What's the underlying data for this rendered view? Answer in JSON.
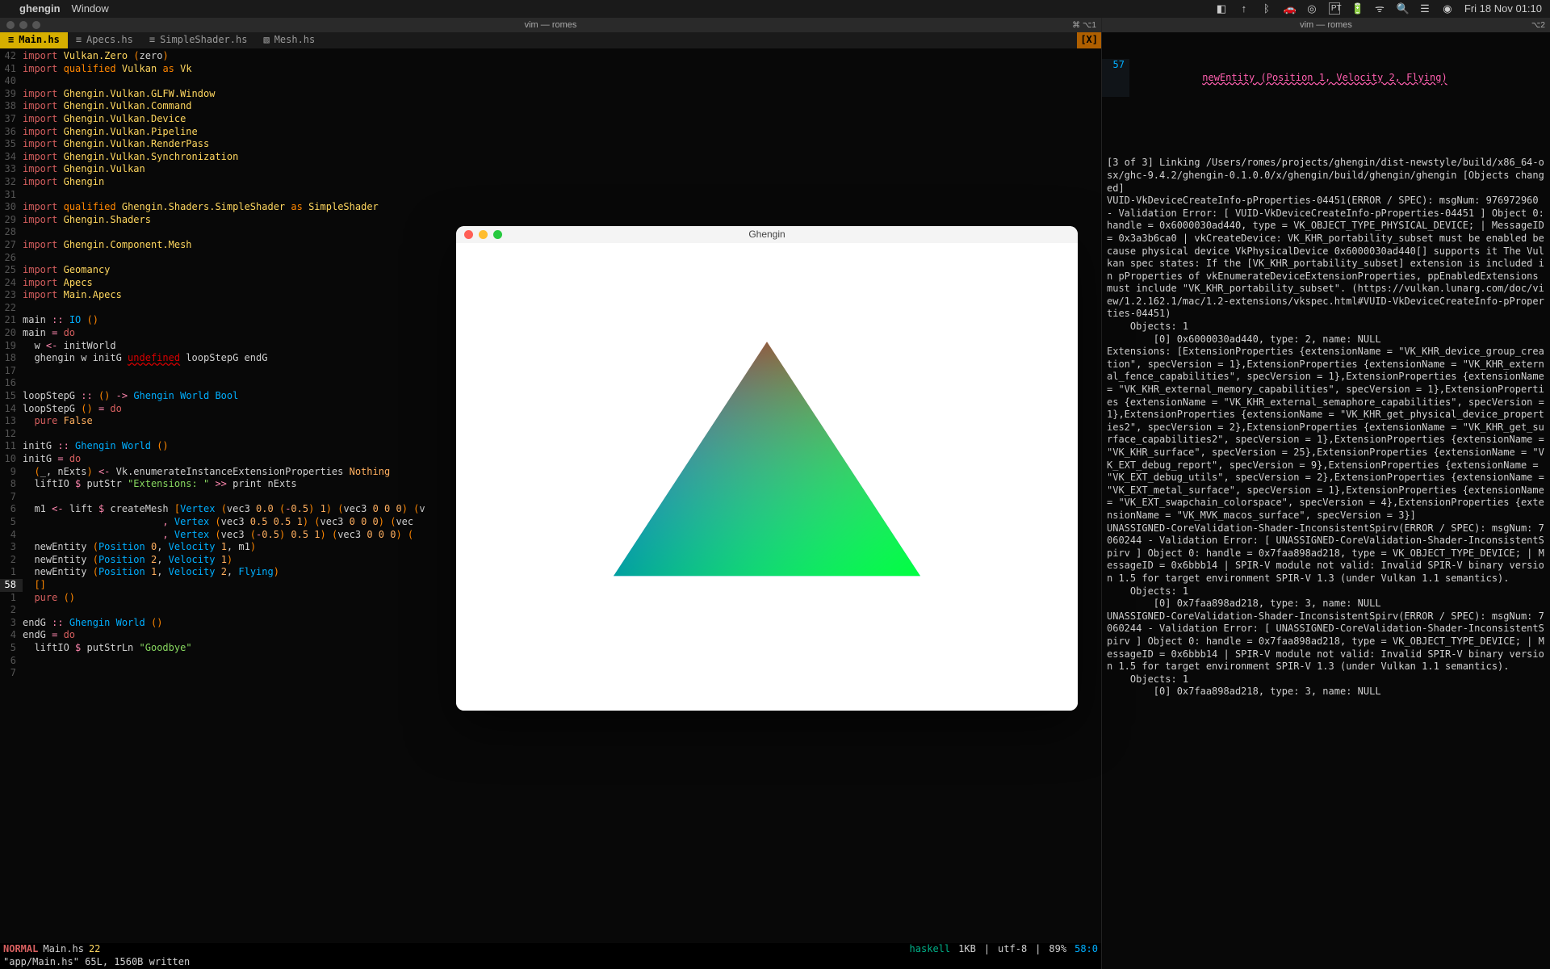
{
  "menubar": {
    "app": "ghengin",
    "menus": [
      "Window"
    ],
    "right": {
      "icons": [
        "square-icon",
        "up-icon",
        "bluetooth-icon",
        "car-icon",
        "target-icon"
      ],
      "lang": "PT",
      "battery": "⚡",
      "wifi": "ᯤ",
      "search": "🔍",
      "cc": "☰",
      "siri": "◉",
      "clock": "Fri 18 Nov  01:10"
    }
  },
  "left_term": {
    "title": "vim — romes",
    "end": "⌘ ⌥1"
  },
  "right_term": {
    "title": "vim — romes",
    "end": "⌥2"
  },
  "tabs": [
    {
      "icon": "≡",
      "label": "Main.hs",
      "active": true
    },
    {
      "icon": "≡",
      "label": "Apecs.hs"
    },
    {
      "icon": "≡",
      "label": "SimpleShader.hs"
    },
    {
      "icon": "▧",
      "label": "Mesh.hs"
    }
  ],
  "tab_marker": "[X]",
  "code": [
    {
      "n": "42",
      "t": [
        [
          "kw",
          "import"
        ],
        [
          "de",
          " "
        ],
        [
          "mod",
          "Vulkan.Zero"
        ],
        [
          "de",
          " "
        ],
        [
          "paren",
          "("
        ],
        [
          "de",
          "zero"
        ],
        [
          "paren",
          ")"
        ]
      ]
    },
    {
      "n": "41",
      "t": [
        [
          "kw",
          "import"
        ],
        [
          "de",
          " "
        ],
        [
          "qual",
          "qualified"
        ],
        [
          "de",
          " "
        ],
        [
          "mod",
          "Vulkan"
        ],
        [
          "de",
          " "
        ],
        [
          "qual",
          "as"
        ],
        [
          "de",
          " "
        ],
        [
          "mod",
          "Vk"
        ]
      ]
    },
    {
      "n": "40",
      "t": []
    },
    {
      "n": "39",
      "t": [
        [
          "kw",
          "import"
        ],
        [
          "de",
          " "
        ],
        [
          "mod",
          "Ghengin.Vulkan.GLFW.Window"
        ]
      ]
    },
    {
      "n": "38",
      "t": [
        [
          "kw",
          "import"
        ],
        [
          "de",
          " "
        ],
        [
          "mod",
          "Ghengin.Vulkan.Command"
        ]
      ]
    },
    {
      "n": "37",
      "t": [
        [
          "kw",
          "import"
        ],
        [
          "de",
          " "
        ],
        [
          "mod",
          "Ghengin.Vulkan.Device"
        ]
      ]
    },
    {
      "n": "36",
      "t": [
        [
          "kw",
          "import"
        ],
        [
          "de",
          " "
        ],
        [
          "mod",
          "Ghengin.Vulkan.Pipeline"
        ]
      ]
    },
    {
      "n": "35",
      "t": [
        [
          "kw",
          "import"
        ],
        [
          "de",
          " "
        ],
        [
          "mod",
          "Ghengin.Vulkan.RenderPass"
        ]
      ]
    },
    {
      "n": "34",
      "t": [
        [
          "kw",
          "import"
        ],
        [
          "de",
          " "
        ],
        [
          "mod",
          "Ghengin.Vulkan.Synchronization"
        ]
      ]
    },
    {
      "n": "33",
      "t": [
        [
          "kw",
          "import"
        ],
        [
          "de",
          " "
        ],
        [
          "mod",
          "Ghengin.Vulkan"
        ]
      ]
    },
    {
      "n": "32",
      "t": [
        [
          "kw",
          "import"
        ],
        [
          "de",
          " "
        ],
        [
          "mod",
          "Ghengin"
        ]
      ]
    },
    {
      "n": "31",
      "t": []
    },
    {
      "n": "30",
      "t": [
        [
          "kw",
          "import"
        ],
        [
          "de",
          " "
        ],
        [
          "qual",
          "qualified"
        ],
        [
          "de",
          " "
        ],
        [
          "mod",
          "Ghengin.Shaders.SimpleShader"
        ],
        [
          "de",
          " "
        ],
        [
          "qual",
          "as"
        ],
        [
          "de",
          " "
        ],
        [
          "mod",
          "SimpleShader"
        ]
      ]
    },
    {
      "n": "29",
      "t": [
        [
          "kw",
          "import"
        ],
        [
          "de",
          " "
        ],
        [
          "mod",
          "Ghengin.Shaders"
        ]
      ]
    },
    {
      "n": "28",
      "t": []
    },
    {
      "n": "27",
      "t": [
        [
          "kw",
          "import"
        ],
        [
          "de",
          " "
        ],
        [
          "mod",
          "Ghengin.Component.Mesh"
        ]
      ]
    },
    {
      "n": "26",
      "t": []
    },
    {
      "n": "25",
      "t": [
        [
          "kw",
          "import"
        ],
        [
          "de",
          " "
        ],
        [
          "mod",
          "Geomancy"
        ]
      ]
    },
    {
      "n": "24",
      "t": [
        [
          "kw",
          "import"
        ],
        [
          "de",
          " "
        ],
        [
          "mod",
          "Apecs"
        ]
      ]
    },
    {
      "n": "23",
      "t": [
        [
          "kw",
          "import"
        ],
        [
          "de",
          " "
        ],
        [
          "mod",
          "Main.Apecs"
        ]
      ]
    },
    {
      "n": "22",
      "t": []
    },
    {
      "n": "21",
      "t": [
        [
          "fn",
          "main "
        ],
        [
          "op",
          ":: "
        ],
        [
          "ty",
          "IO "
        ],
        [
          "paren",
          "()"
        ]
      ]
    },
    {
      "n": "20",
      "t": [
        [
          "fn",
          "main "
        ],
        [
          "op",
          "= "
        ],
        [
          "kw",
          "do"
        ]
      ]
    },
    {
      "n": "19",
      "t": [
        [
          "de",
          "  w "
        ],
        [
          "op",
          "<- "
        ],
        [
          "de",
          "initWorld"
        ]
      ]
    },
    {
      "n": "18",
      "t": [
        [
          "de",
          "  ghengin w initG "
        ],
        [
          "err",
          "undefined"
        ],
        [
          "de",
          " loopStepG endG"
        ]
      ]
    },
    {
      "n": "17",
      "t": []
    },
    {
      "n": "16",
      "t": []
    },
    {
      "n": "15",
      "t": [
        [
          "fn",
          "loopStepG "
        ],
        [
          "op",
          ":: "
        ],
        [
          "paren",
          "() "
        ],
        [
          "op",
          "-> "
        ],
        [
          "ty",
          "Ghengin World Bool"
        ]
      ]
    },
    {
      "n": "14",
      "t": [
        [
          "fn",
          "loopStepG "
        ],
        [
          "paren",
          "() "
        ],
        [
          "op",
          "= "
        ],
        [
          "kw",
          "do"
        ]
      ]
    },
    {
      "n": "13",
      "t": [
        [
          "de",
          "  "
        ],
        [
          "kw",
          "pure "
        ],
        [
          "at",
          "False"
        ]
      ]
    },
    {
      "n": "12",
      "t": []
    },
    {
      "n": "11",
      "t": [
        [
          "fn",
          "initG "
        ],
        [
          "op",
          ":: "
        ],
        [
          "ty",
          "Ghengin World "
        ],
        [
          "paren",
          "()"
        ]
      ]
    },
    {
      "n": "10",
      "t": [
        [
          "fn",
          "initG "
        ],
        [
          "op",
          "= "
        ],
        [
          "kw",
          "do"
        ]
      ]
    },
    {
      "n": "9",
      "t": [
        [
          "de",
          "  "
        ],
        [
          "paren",
          "("
        ],
        [
          "de",
          "_, nExts"
        ],
        [
          "paren",
          ") "
        ],
        [
          "op",
          "<- "
        ],
        [
          "de",
          "Vk.enumerateInstanceExtensionProperties "
        ],
        [
          "at",
          "Nothing"
        ]
      ]
    },
    {
      "n": "8",
      "t": [
        [
          "de",
          "  liftIO "
        ],
        [
          "op",
          "$ "
        ],
        [
          "de",
          "putStr "
        ],
        [
          "str",
          "\"Extensions: \""
        ],
        [
          "de",
          " "
        ],
        [
          "op",
          ">> "
        ],
        [
          "de",
          "print nExts"
        ]
      ]
    },
    {
      "n": "7",
      "t": []
    },
    {
      "n": "6",
      "t": [
        [
          "de",
          "  m1 "
        ],
        [
          "op",
          "<- "
        ],
        [
          "de",
          "lift "
        ],
        [
          "op",
          "$ "
        ],
        [
          "de",
          "createMesh "
        ],
        [
          "paren",
          "["
        ],
        [
          "ty",
          "Vertex "
        ],
        [
          "paren",
          "("
        ],
        [
          "de",
          "vec3 "
        ],
        [
          "at",
          "0.0 "
        ],
        [
          "paren",
          "("
        ],
        [
          "op",
          "-"
        ],
        [
          "at",
          "0.5"
        ],
        [
          "paren",
          ") "
        ],
        [
          "at",
          "1"
        ],
        [
          "paren",
          ") ("
        ],
        [
          "de",
          "vec3 "
        ],
        [
          "at",
          "0 0 0"
        ],
        [
          "paren",
          ") ("
        ],
        [
          "de",
          "v"
        ]
      ]
    },
    {
      "n": "5",
      "t": [
        [
          "de",
          "                        "
        ],
        [
          "op",
          ", "
        ],
        [
          "ty",
          "Vertex "
        ],
        [
          "paren",
          "("
        ],
        [
          "de",
          "vec3 "
        ],
        [
          "at",
          "0.5 0.5 1"
        ],
        [
          "paren",
          ") ("
        ],
        [
          "de",
          "vec3 "
        ],
        [
          "at",
          "0 0 0"
        ],
        [
          "paren",
          ") ("
        ],
        [
          "de",
          "vec"
        ]
      ]
    },
    {
      "n": "4",
      "t": [
        [
          "de",
          "                        "
        ],
        [
          "op",
          ", "
        ],
        [
          "ty",
          "Vertex "
        ],
        [
          "paren",
          "("
        ],
        [
          "de",
          "vec3 "
        ],
        [
          "paren",
          "("
        ],
        [
          "op",
          "-"
        ],
        [
          "at",
          "0.5"
        ],
        [
          "paren",
          ") "
        ],
        [
          "at",
          "0.5 1"
        ],
        [
          "paren",
          ") ("
        ],
        [
          "de",
          "vec3 "
        ],
        [
          "at",
          "0 0 0"
        ],
        [
          "paren",
          ") ("
        ]
      ]
    },
    {
      "n": "3",
      "t": [
        [
          "de",
          "  newEntity "
        ],
        [
          "paren",
          "("
        ],
        [
          "ty",
          "Position "
        ],
        [
          "at",
          "0"
        ],
        [
          "de",
          ", "
        ],
        [
          "ty",
          "Velocity "
        ],
        [
          "at",
          "1"
        ],
        [
          "de",
          ", m1"
        ],
        [
          "paren",
          ")"
        ]
      ]
    },
    {
      "n": "2",
      "t": [
        [
          "de",
          "  newEntity "
        ],
        [
          "paren",
          "("
        ],
        [
          "ty",
          "Position "
        ],
        [
          "at",
          "2"
        ],
        [
          "de",
          ", "
        ],
        [
          "ty",
          "Velocity "
        ],
        [
          "at",
          "1"
        ],
        [
          "paren",
          ")"
        ]
      ]
    },
    {
      "n": "1",
      "t": [
        [
          "de",
          "  newEntity "
        ],
        [
          "paren",
          "("
        ],
        [
          "ty",
          "Position "
        ],
        [
          "at",
          "1"
        ],
        [
          "de",
          ", "
        ],
        [
          "ty",
          "Velocity "
        ],
        [
          "at",
          "2"
        ],
        [
          "de",
          ", "
        ],
        [
          "ty",
          "Flying"
        ],
        [
          "paren",
          ")"
        ]
      ]
    },
    {
      "n": "58",
      "t": [
        [
          "de",
          "  "
        ],
        [
          "paren",
          "[]"
        ]
      ],
      "cursor": true
    },
    {
      "n": "1",
      "t": [
        [
          "de",
          "  "
        ],
        [
          "kw",
          "pure "
        ],
        [
          "paren",
          "()"
        ]
      ]
    },
    {
      "n": "2",
      "t": []
    },
    {
      "n": "3",
      "t": [
        [
          "fn",
          "endG "
        ],
        [
          "op",
          ":: "
        ],
        [
          "ty",
          "Ghengin World "
        ],
        [
          "paren",
          "()"
        ]
      ]
    },
    {
      "n": "4",
      "t": [
        [
          "fn",
          "endG "
        ],
        [
          "op",
          "= "
        ],
        [
          "kw",
          "do"
        ]
      ]
    },
    {
      "n": "5",
      "t": [
        [
          "de",
          "  liftIO "
        ],
        [
          "op",
          "$ "
        ],
        [
          "de",
          "putStrLn "
        ],
        [
          "str",
          "\"Goodbye\""
        ]
      ]
    },
    {
      "n": "6",
      "t": []
    },
    {
      "n": "7",
      "t": []
    }
  ],
  "statusline": {
    "mode": "NORMAL",
    "file": "Main.hs",
    "line": "22",
    "ft": "haskell",
    "size": "1KB",
    "enc": "utf-8",
    "pct": "89%",
    "pos": "58:0"
  },
  "msgline": "\"app/Main.hs\" 65L, 1560B written",
  "right_header": {
    "lnum": "57",
    "call": "newEntity (Position 1, Velocity 2, Flying)"
  },
  "right_log": "[3 of 3] Linking /Users/romes/projects/ghengin/dist-newstyle/build/x86_64-osx/ghc-9.4.2/ghengin-0.1.0.0/x/ghengin/build/ghengin/ghengin [Objects changed]\nVUID-VkDeviceCreateInfo-pProperties-04451(ERROR / SPEC): msgNum: 976972960 - Validation Error: [ VUID-VkDeviceCreateInfo-pProperties-04451 ] Object 0: handle = 0x6000030ad440, type = VK_OBJECT_TYPE_PHYSICAL_DEVICE; | MessageID = 0x3a3b6ca0 | vkCreateDevice: VK_KHR_portability_subset must be enabled because physical device VkPhysicalDevice 0x6000030ad440[] supports it The Vulkan spec states: If the [VK_KHR_portability_subset] extension is included in pProperties of vkEnumerateDeviceExtensionProperties, ppEnabledExtensions must include \"VK_KHR_portability_subset\". (https://vulkan.lunarg.com/doc/view/1.2.162.1/mac/1.2-extensions/vkspec.html#VUID-VkDeviceCreateInfo-pProperties-04451)\n    Objects: 1\n        [0] 0x6000030ad440, type: 2, name: NULL\nExtensions: [ExtensionProperties {extensionName = \"VK_KHR_device_group_creation\", specVersion = 1},ExtensionProperties {extensionName = \"VK_KHR_external_fence_capabilities\", specVersion = 1},ExtensionProperties {extensionName = \"VK_KHR_external_memory_capabilities\", specVersion = 1},ExtensionProperties {extensionName = \"VK_KHR_external_semaphore_capabilities\", specVersion = 1},ExtensionProperties {extensionName = \"VK_KHR_get_physical_device_properties2\", specVersion = 2},ExtensionProperties {extensionName = \"VK_KHR_get_surface_capabilities2\", specVersion = 1},ExtensionProperties {extensionName = \"VK_KHR_surface\", specVersion = 25},ExtensionProperties {extensionName = \"VK_EXT_debug_report\", specVersion = 9},ExtensionProperties {extensionName = \"VK_EXT_debug_utils\", specVersion = 2},ExtensionProperties {extensionName = \"VK_EXT_metal_surface\", specVersion = 1},ExtensionProperties {extensionName = \"VK_EXT_swapchain_colorspace\", specVersion = 4},ExtensionProperties {extensionName = \"VK_MVK_macos_surface\", specVersion = 3}]\nUNASSIGNED-CoreValidation-Shader-InconsistentSpirv(ERROR / SPEC): msgNum: 7060244 - Validation Error: [ UNASSIGNED-CoreValidation-Shader-InconsistentSpirv ] Object 0: handle = 0x7faa898ad218, type = VK_OBJECT_TYPE_DEVICE; | MessageID = 0x6bbb14 | SPIR-V module not valid: Invalid SPIR-V binary version 1.5 for target environment SPIR-V 1.3 (under Vulkan 1.1 semantics).\n    Objects: 1\n        [0] 0x7faa898ad218, type: 3, name: NULL\nUNASSIGNED-CoreValidation-Shader-InconsistentSpirv(ERROR / SPEC): msgNum: 7060244 - Validation Error: [ UNASSIGNED-CoreValidation-Shader-InconsistentSpirv ] Object 0: handle = 0x7faa898ad218, type = VK_OBJECT_TYPE_DEVICE; | MessageID = 0x6bbb14 | SPIR-V module not valid: Invalid SPIR-V binary version 1.5 for target environment SPIR-V 1.3 (under Vulkan 1.1 semantics).\n    Objects: 1\n        [0] 0x7faa898ad218, type: 3, name: NULL",
  "appwin": {
    "title": "Ghengin"
  }
}
